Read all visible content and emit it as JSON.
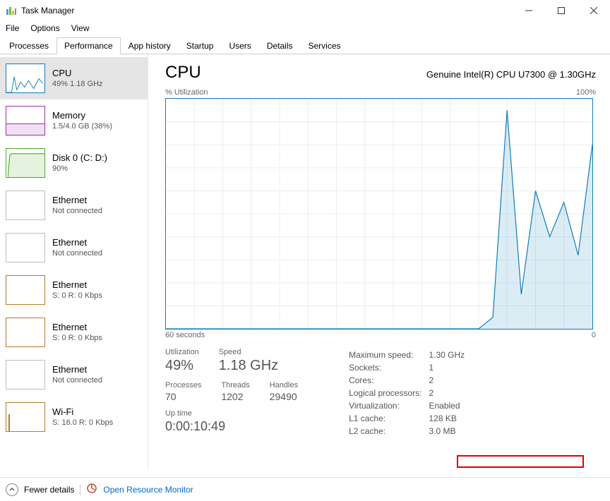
{
  "window": {
    "title": "Task Manager"
  },
  "menu": {
    "file": "File",
    "options": "Options",
    "view": "View"
  },
  "tabs": {
    "processes": "Processes",
    "performance": "Performance",
    "app_history": "App history",
    "startup": "Startup",
    "users": "Users",
    "details": "Details",
    "services": "Services"
  },
  "sidebar": [
    {
      "title": "CPU",
      "sub": "49% 1.18 GHz",
      "name": "sidebar-item-cpu"
    },
    {
      "title": "Memory",
      "sub": "1.5/4.0 GB (38%)",
      "name": "sidebar-item-memory"
    },
    {
      "title": "Disk 0 (C: D:)",
      "sub": "90%",
      "name": "sidebar-item-disk0"
    },
    {
      "title": "Ethernet",
      "sub": "Not connected",
      "name": "sidebar-item-ethernet-1"
    },
    {
      "title": "Ethernet",
      "sub": "Not connected",
      "name": "sidebar-item-ethernet-2"
    },
    {
      "title": "Ethernet",
      "sub": "S: 0 R: 0 Kbps",
      "name": "sidebar-item-ethernet-3"
    },
    {
      "title": "Ethernet",
      "sub": "S: 0 R: 0 Kbps",
      "name": "sidebar-item-ethernet-4"
    },
    {
      "title": "Ethernet",
      "sub": "Not connected",
      "name": "sidebar-item-ethernet-5"
    },
    {
      "title": "Wi-Fi",
      "sub": "S: 16.0 R: 0 Kbps",
      "name": "sidebar-item-wifi"
    }
  ],
  "main": {
    "title": "CPU",
    "cpu_name": "Genuine Intel(R) CPU U7300 @ 1.30GHz",
    "ylabel": "% Utilization",
    "ymax": "100%",
    "xmin": "60 seconds",
    "xmax": "0",
    "stats_left": {
      "utilization_label": "Utilization",
      "utilization": "49%",
      "speed_label": "Speed",
      "speed": "1.18 GHz",
      "processes_label": "Processes",
      "processes": "70",
      "threads_label": "Threads",
      "threads": "1202",
      "handles_label": "Handles",
      "handles": "29490",
      "uptime_label": "Up time",
      "uptime": "0:00:10:49"
    },
    "stats_right": [
      {
        "k": "Maximum speed:",
        "v": "1.30 GHz"
      },
      {
        "k": "Sockets:",
        "v": "1"
      },
      {
        "k": "Cores:",
        "v": "2"
      },
      {
        "k": "Logical processors:",
        "v": "2"
      },
      {
        "k": "Virtualization:",
        "v": "Enabled"
      },
      {
        "k": "L1 cache:",
        "v": "128 KB"
      },
      {
        "k": "L2 cache:",
        "v": "3.0 MB"
      }
    ]
  },
  "footer": {
    "fewer": "Fewer details",
    "resmon": "Open Resource Monitor"
  },
  "chart_data": {
    "type": "area",
    "title": "CPU % Utilization",
    "xlabel": "Time (seconds ago)",
    "ylabel": "% Utilization",
    "xlim": [
      60,
      0
    ],
    "ylim": [
      0,
      100
    ],
    "x_seconds_ago": [
      60,
      58,
      56,
      54,
      52,
      50,
      48,
      46,
      44,
      42,
      40,
      38,
      36,
      34,
      32,
      30,
      28,
      26,
      24,
      22,
      20,
      18,
      16,
      14,
      12,
      10,
      8,
      6,
      4,
      2,
      0
    ],
    "values": [
      0,
      0,
      0,
      0,
      0,
      0,
      0,
      0,
      0,
      0,
      0,
      0,
      0,
      0,
      0,
      0,
      0,
      0,
      0,
      0,
      0,
      0,
      0,
      5,
      95,
      15,
      60,
      40,
      55,
      32,
      80
    ]
  }
}
